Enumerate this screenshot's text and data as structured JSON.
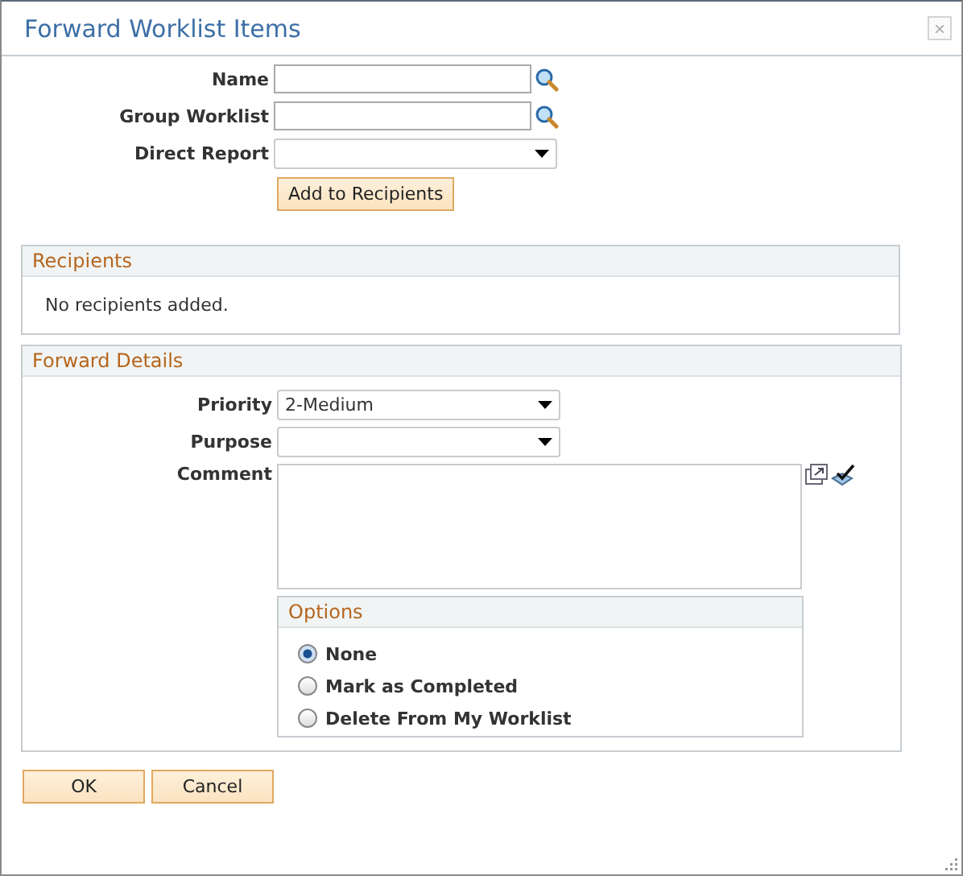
{
  "window": {
    "title": "Forward Worklist Items",
    "close": "×"
  },
  "fields": [
    {
      "label": "Name",
      "kind": "lookup"
    },
    {
      "label": "Group Worklist",
      "kind": "lookup"
    },
    {
      "label": "Direct Report",
      "kind": "select"
    }
  ],
  "add_button": "Add to Recipients",
  "recipients": {
    "title": "Recipients",
    "message": "No recipients added."
  },
  "forward_details": {
    "title": "Forward Details",
    "fields": [
      {
        "label": "Priority",
        "kind": "select",
        "value": "2-Medium"
      },
      {
        "label": "Purpose",
        "kind": "select"
      },
      {
        "label": "Comment",
        "kind": "textarea"
      }
    ],
    "options": {
      "title": "Options",
      "items": [
        {
          "label": "None",
          "selected": true
        },
        {
          "label": "Mark as Completed",
          "selected": false
        },
        {
          "label": "Delete From My Worklist",
          "selected": false
        }
      ]
    }
  },
  "buttons": [
    "OK",
    "Cancel"
  ]
}
